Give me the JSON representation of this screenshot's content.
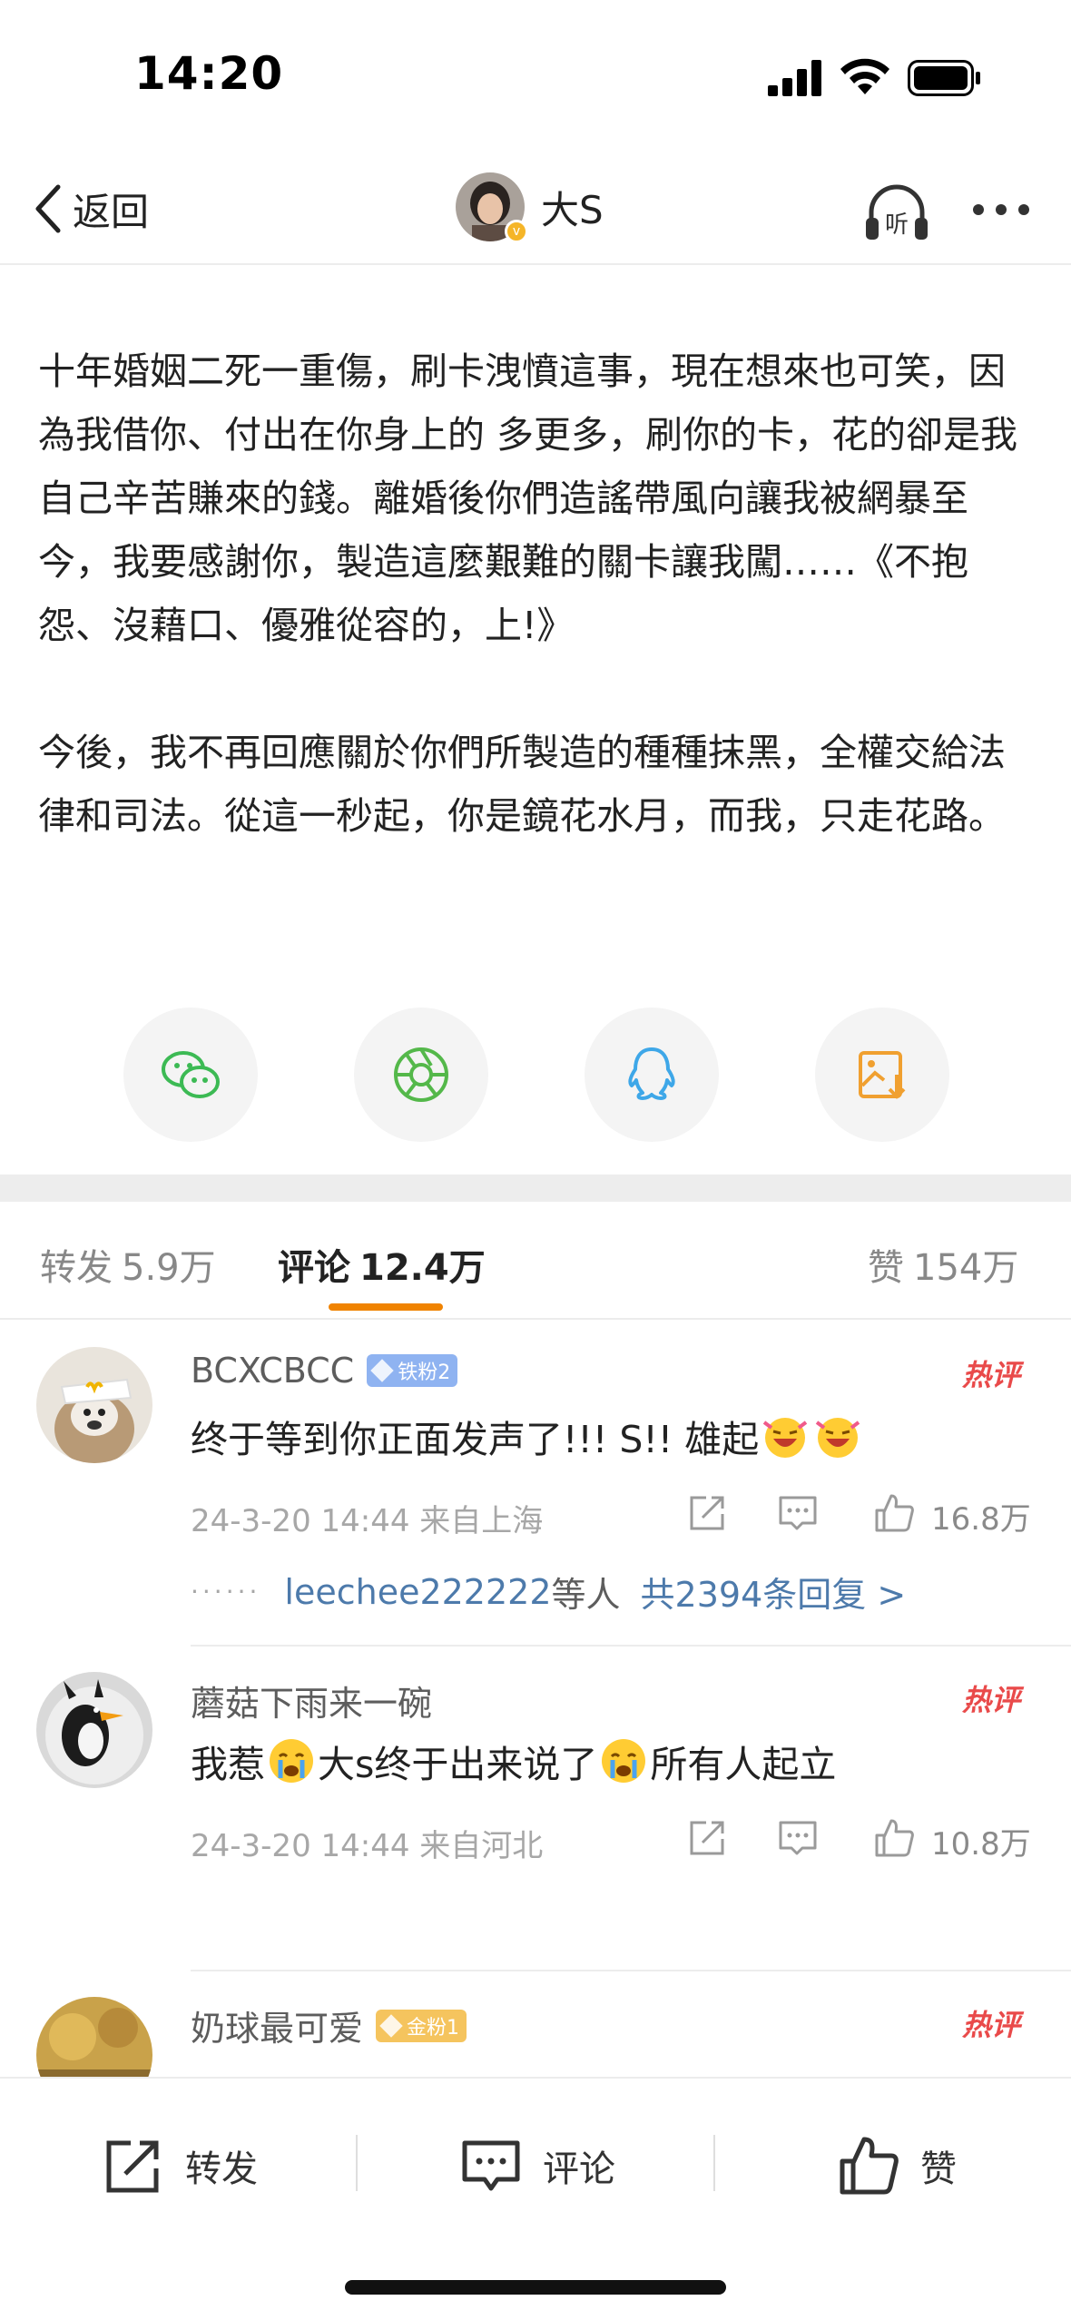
{
  "status_bar": {
    "time": "14:20"
  },
  "nav": {
    "back_label": "返回",
    "author_name": "大S"
  },
  "post": {
    "paragraphs": [
      "十年婚姻二死一重傷，刷卡洩憤這事，現在想來也可笑，因為我借你、付出在你身上的 多更多，刷你的卡，花的卻是我自己辛苦賺來的錢。離婚後你們造謠帶風向讓我被網暴至今，我要感謝你，製造這麼艱難的關卡讓我闖……《不抱怨、沒藉口、優雅從容的，上!》",
      "今後，我不再回應關於你們所製造的種種抹黑，全權交給法律和司法。從這一秒起，你是鏡花水月，而我，只走花路。"
    ]
  },
  "share_icons": [
    "wechat-icon",
    "moments-icon",
    "qq-icon",
    "save-image-icon"
  ],
  "tabs": {
    "repost": {
      "label": "转发",
      "count": "5.9万"
    },
    "comments": {
      "label": "评论",
      "count": "12.4万"
    },
    "likes": {
      "label": "赞",
      "count": "154万"
    }
  },
  "comments": [
    {
      "user": "BCXCBCC",
      "badge": "铁粉2",
      "hot_tag": "热评",
      "text_parts": [
        "终于等到你正面发声了!!!  S!!  雄起"
      ],
      "time_location": "24-3-20 14:44  来自上海",
      "likes": "16.8万",
      "reply": {
        "user": "leechee222222",
        "mid": "等人",
        "count_text": "共2394条回复 >"
      }
    },
    {
      "user": "蘑菇下雨来一碗",
      "hot_tag": "热评",
      "text_parts": [
        "我惹",
        "大s终于出来说了",
        "所有人起立"
      ],
      "time_location": "24-3-20 14:44  来自河北",
      "likes": "10.8万"
    },
    {
      "user": "奶球最可爱",
      "badge": "金粉1",
      "hot_tag": "热评"
    }
  ],
  "bottom_bar": {
    "repost": "转发",
    "comment": "评论",
    "like": "赞"
  },
  "colors": {
    "accent": "#f08300",
    "link": "#4d7aab",
    "hot": "#e94a4a"
  }
}
